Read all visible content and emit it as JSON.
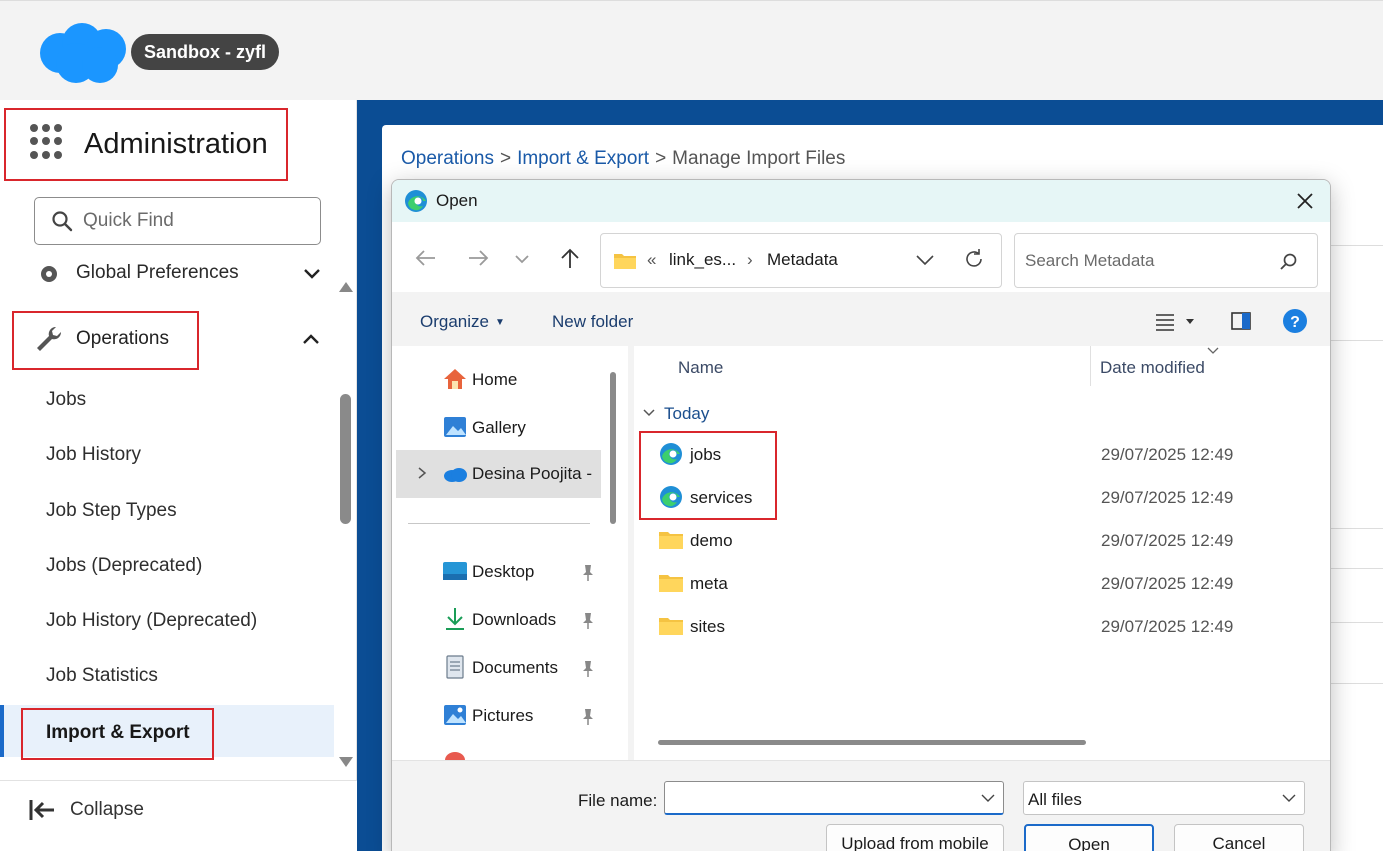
{
  "header": {
    "org_badge": "Sandbox - zyfl",
    "brand_color": "#1b96ff"
  },
  "sidebar": {
    "title": "Administration",
    "quick_find_placeholder": "Quick Find",
    "global_preferences": "Global Preferences",
    "operations": "Operations",
    "items": [
      {
        "label": "Jobs"
      },
      {
        "label": "Job History"
      },
      {
        "label": "Job Step Types"
      },
      {
        "label": "Jobs (Deprecated)"
      },
      {
        "label": "Job History (Deprecated)"
      },
      {
        "label": "Job Statistics"
      },
      {
        "label": "Import & Export"
      }
    ],
    "collapse_label": "Collapse"
  },
  "breadcrumb": {
    "part1": "Operations",
    "part2": "Import & Export",
    "current": "Manage Import Files",
    "separator": ">"
  },
  "dialog": {
    "title": "Open",
    "address": {
      "prefix": "«",
      "crumb1": "link_es...",
      "separator": "›",
      "crumb2": "Metadata"
    },
    "search_placeholder": "Search Metadata",
    "toolbar": {
      "organize": "Organize",
      "new_folder": "New folder"
    },
    "nav_pane": {
      "home": "Home",
      "gallery": "Gallery",
      "onedrive": "Desina Poojita -",
      "desktop": "Desktop",
      "downloads": "Downloads",
      "documents": "Documents",
      "pictures": "Pictures"
    },
    "columns": {
      "name": "Name",
      "date_modified": "Date modified"
    },
    "group": "Today",
    "files": [
      {
        "name": "jobs",
        "date": "29/07/2025 12:49",
        "icon": "edge-html-icon"
      },
      {
        "name": "services",
        "date": "29/07/2025 12:49",
        "icon": "edge-html-icon"
      },
      {
        "name": "demo",
        "date": "29/07/2025 12:49",
        "icon": "folder-icon"
      },
      {
        "name": "meta",
        "date": "29/07/2025 12:49",
        "icon": "folder-icon"
      },
      {
        "name": "sites",
        "date": "29/07/2025 12:49",
        "icon": "folder-icon"
      }
    ],
    "file_name_label": "File name:",
    "file_name_value": "",
    "file_type": "All files",
    "buttons": {
      "upload": "Upload from mobile",
      "open": "Open",
      "cancel": "Cancel"
    }
  },
  "colors": {
    "highlight_box": "#d9262c",
    "main_blue": "#0b4d94",
    "link": "#1a5aa8"
  }
}
